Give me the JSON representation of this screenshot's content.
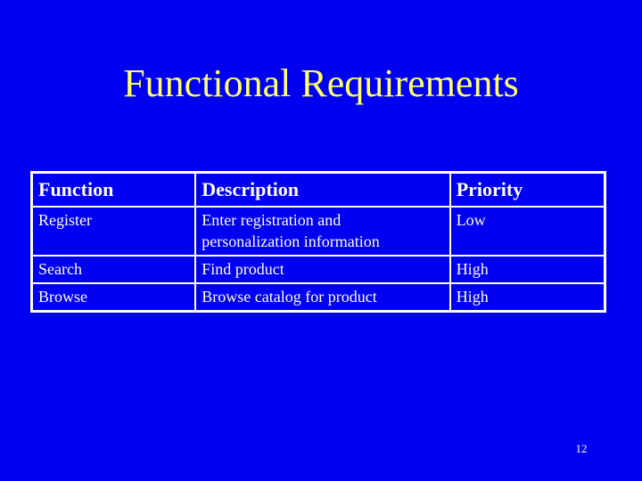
{
  "slide": {
    "title": "Functional Requirements",
    "page_number": "12",
    "colors": {
      "background": "#0000f0",
      "title": "#ffff66",
      "text": "#ffffff"
    }
  },
  "table": {
    "headers": [
      "Function",
      "Description",
      "Priority"
    ],
    "rows": [
      {
        "function": "Register",
        "description": "Enter registration and personalization information",
        "priority": "Low"
      },
      {
        "function": "Search",
        "description": "Find product",
        "priority": "High"
      },
      {
        "function": "Browse",
        "description": "Browse catalog for product",
        "priority": "High"
      }
    ]
  }
}
